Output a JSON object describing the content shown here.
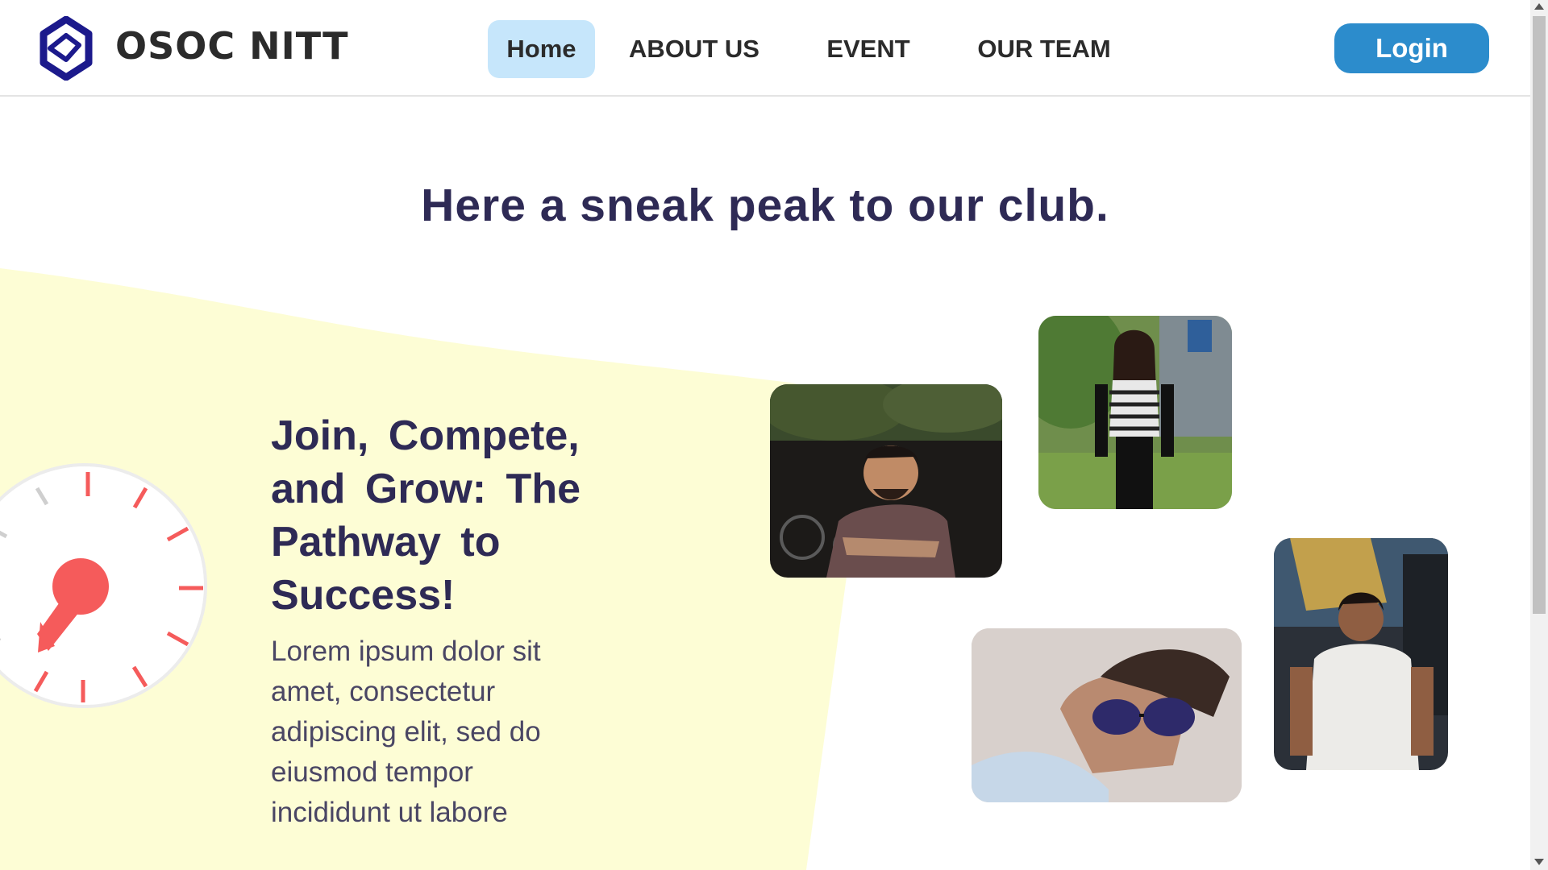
{
  "brand": {
    "name": "OSOC NITT"
  },
  "nav": {
    "items": [
      {
        "label": "Home",
        "active": true
      },
      {
        "label": "ABOUT US",
        "active": false
      },
      {
        "label": "EVENT",
        "active": false
      },
      {
        "label": "OUR TEAM",
        "active": false
      }
    ]
  },
  "login": {
    "label": "Login"
  },
  "section": {
    "title": "Here a sneak peak to our club."
  },
  "feature": {
    "headline": "Join, Compete, and Grow: The Pathway to Success!",
    "body": "Lorem ipsum dolor sit amet, consectetur adipiscing elit, sed do eiusmod tempor incididunt ut labore"
  },
  "colors": {
    "accent": "#2c8ccc",
    "nav_active_bg": "#c6e6fb",
    "heading": "#2e2a55",
    "bg_shape": "#fdfdd5",
    "gauge_red": "#f55b5b"
  },
  "icons": {
    "logo": "osoc-logo-icon",
    "gauge": "stopwatch-icon"
  }
}
